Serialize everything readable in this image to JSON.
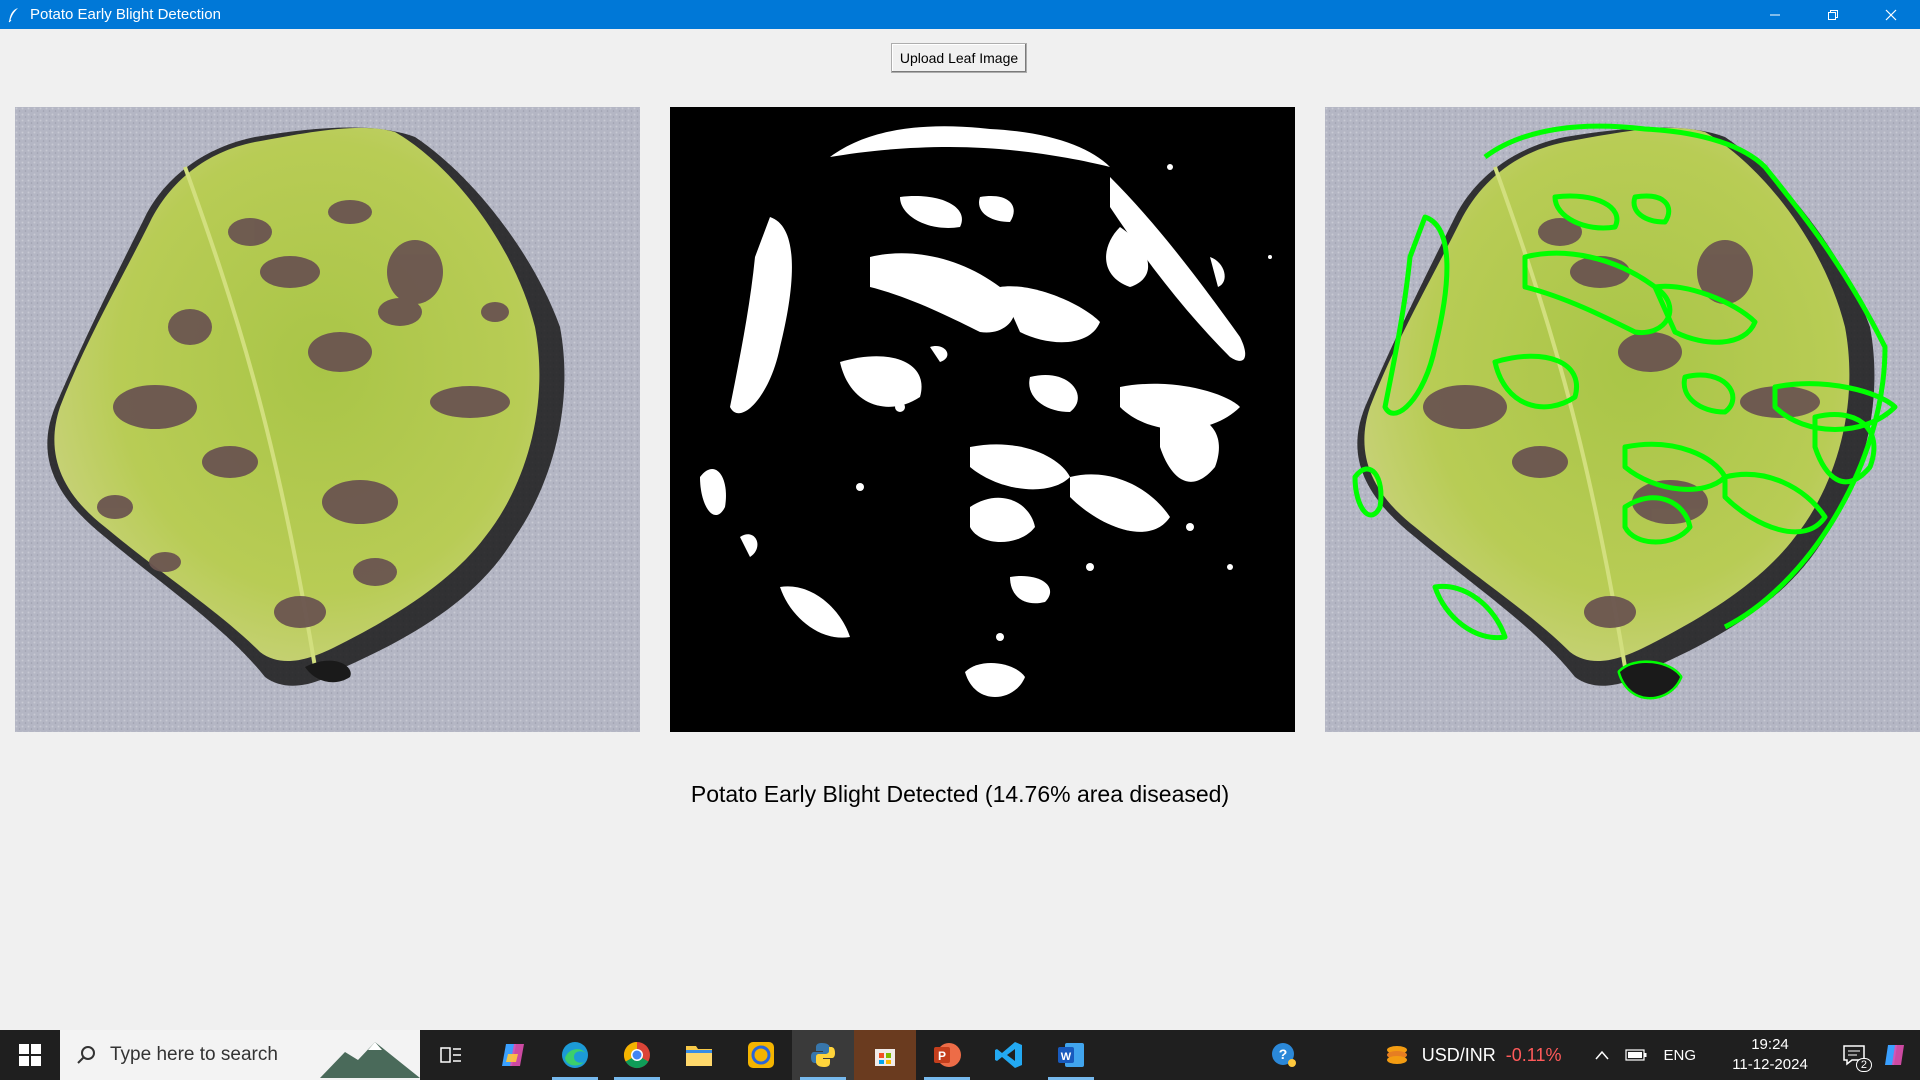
{
  "window": {
    "title": "Potato Early Blight Detection"
  },
  "toolbar": {
    "upload_label": "Upload Leaf Image"
  },
  "result": {
    "text": "Potato Early Blight Detected (14.76% area diseased)",
    "diseased_percent": 14.76
  },
  "colors": {
    "titlebar": "#0078d7",
    "contour": "#00ff00",
    "leaf": "#a8c44a",
    "lesion": "#6b5550",
    "background_fabric": "#b4b6c4"
  },
  "taskbar": {
    "search_placeholder": "Type here to search",
    "apps": [
      {
        "name": "task-view-icon"
      },
      {
        "name": "copilot-icon"
      },
      {
        "name": "edge-icon"
      },
      {
        "name": "chrome-icon"
      },
      {
        "name": "file-explorer-icon"
      },
      {
        "name": "app-circle-icon"
      },
      {
        "name": "python-icon"
      },
      {
        "name": "store-icon"
      },
      {
        "name": "powerpoint-icon"
      },
      {
        "name": "vscode-icon"
      },
      {
        "name": "word-icon"
      }
    ],
    "tray": {
      "fx_label": "USD/INR",
      "fx_change": "-0.11%",
      "language": "ENG",
      "time": "19:24",
      "date": "11-12-2024",
      "notification_count": "2"
    }
  }
}
